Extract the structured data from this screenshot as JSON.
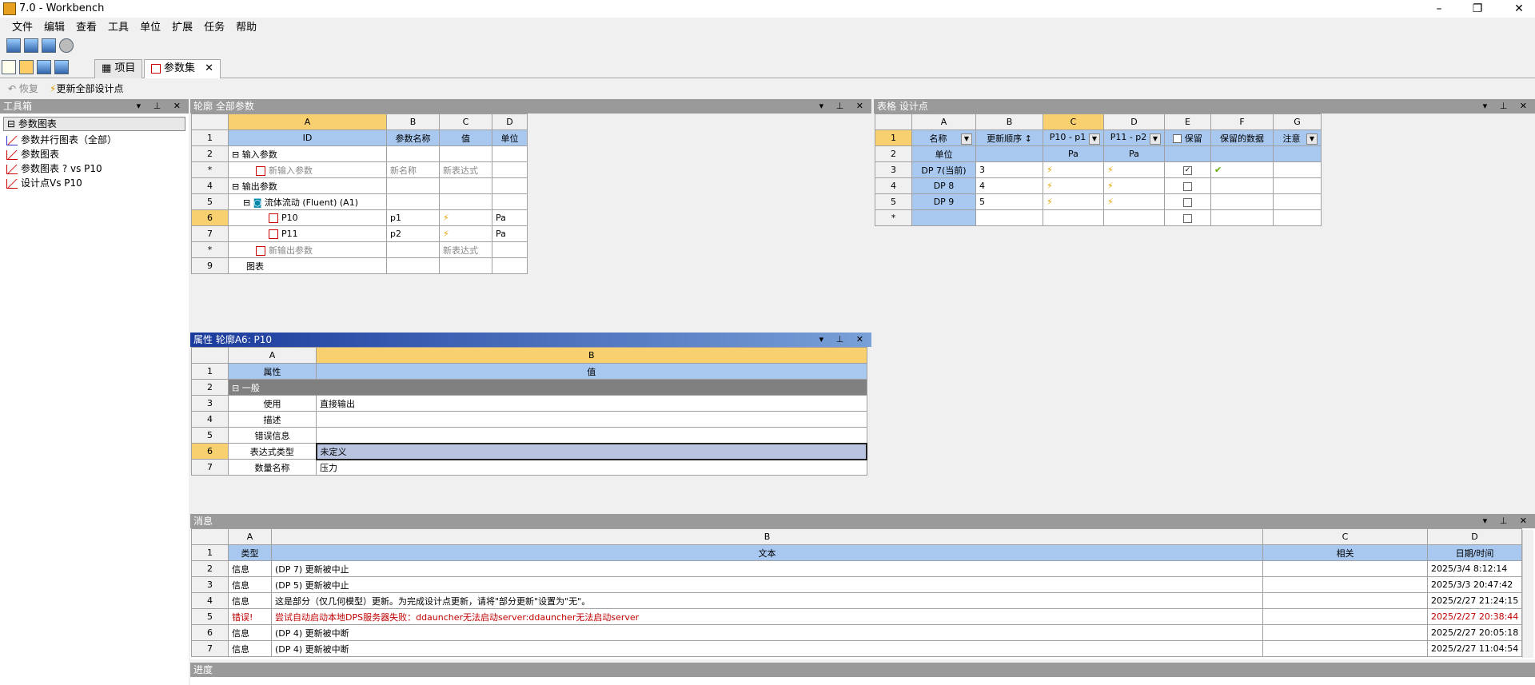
{
  "window": {
    "title": "7.0 - Workbench"
  },
  "menu": [
    "文件",
    "编辑",
    "查看",
    "工具",
    "单位",
    "扩展",
    "任务",
    "帮助"
  ],
  "tabs": {
    "project": "项目",
    "params": "参数集"
  },
  "subtool": {
    "restore": "恢复",
    "update_all": "更新全部设计点"
  },
  "toolbox": {
    "title": "工具箱",
    "group": "参数图表",
    "items": [
      "参数并行图表（全部）",
      "参数图表",
      "参数图表 ? vs P10",
      "设计点Vs P10"
    ]
  },
  "outline": {
    "title": "轮廓 全部参数",
    "cols": [
      "A",
      "B",
      "C",
      "D"
    ],
    "header": [
      "ID",
      "参数名称",
      "值",
      "单位"
    ],
    "rows": [
      {
        "n": "2",
        "a": "输入参数",
        "b": "",
        "c": "",
        "d": ""
      },
      {
        "n": "*",
        "a": "新输入参数",
        "b": "新名称",
        "c": "新表达式",
        "d": ""
      },
      {
        "n": "4",
        "a": "输出参数",
        "b": "",
        "c": "",
        "d": ""
      },
      {
        "n": "5",
        "a": "流体流动 (Fluent) (A1)",
        "b": "",
        "c": "",
        "d": ""
      },
      {
        "n": "6",
        "a": "P10",
        "b": "p1",
        "c": "",
        "d": "Pa"
      },
      {
        "n": "7",
        "a": "P11",
        "b": "p2",
        "c": "",
        "d": "Pa"
      },
      {
        "n": "*",
        "a": "新输出参数",
        "b": "",
        "c": "新表达式",
        "d": ""
      },
      {
        "n": "9",
        "a": "图表",
        "b": "",
        "c": "",
        "d": ""
      }
    ]
  },
  "props": {
    "title": "属性 轮廓A6: P10",
    "cols": [
      "A",
      "B"
    ],
    "header": [
      "属性",
      "值"
    ],
    "group": "一般",
    "rows": [
      [
        "3",
        "使用",
        "直接输出"
      ],
      [
        "4",
        "描述",
        ""
      ],
      [
        "5",
        "错误信息",
        ""
      ],
      [
        "6",
        "表达式类型",
        "未定义"
      ],
      [
        "7",
        "数量名称",
        "压力"
      ]
    ]
  },
  "dp": {
    "title": "表格 设计点",
    "cols": [
      "A",
      "B",
      "C",
      "D",
      "E",
      "F",
      "G"
    ],
    "header": [
      "名称",
      "更新顺序",
      "P10 - p1",
      "P11 - p2",
      "保留",
      "保留的数据",
      "注意"
    ],
    "units": [
      "单位",
      "",
      "Pa",
      "Pa",
      "",
      "",
      ""
    ],
    "rows": [
      {
        "n": "3",
        "name": "DP 7(当前)",
        "order": "3"
      },
      {
        "n": "4",
        "name": "DP 8",
        "order": "4"
      },
      {
        "n": "5",
        "name": "DP 9",
        "order": "5"
      }
    ]
  },
  "messages": {
    "title": "消息",
    "cols": [
      "A",
      "B",
      "C",
      "D"
    ],
    "header": [
      "类型",
      "文本",
      "相关",
      "日期/时间"
    ],
    "rows": [
      [
        "2",
        "信息",
        "(DP 7) 更新被中止",
        "",
        "2025/3/4 8:12:14"
      ],
      [
        "3",
        "信息",
        "(DP 5) 更新被中止",
        "",
        "2025/3/3 20:47:42"
      ],
      [
        "4",
        "信息",
        "这是部分（仅几何模型）更新。为完成设计点更新，请将\"部分更新\"设置为\"无\"。",
        "",
        "2025/2/27 21:24:15"
      ],
      [
        "5",
        "错误!",
        "尝试自动启动本地DPS服务器失败：ddauncher无法启动server:ddauncher无法启动server",
        "",
        "2025/2/27 20:38:44"
      ],
      [
        "6",
        "信息",
        "(DP 4) 更新被中断",
        "",
        "2025/2/27 20:05:18"
      ],
      [
        "7",
        "信息",
        "(DP 4) 更新被中断",
        "",
        "2025/2/27 11:04:54"
      ]
    ]
  },
  "progress": {
    "title": "进度"
  }
}
